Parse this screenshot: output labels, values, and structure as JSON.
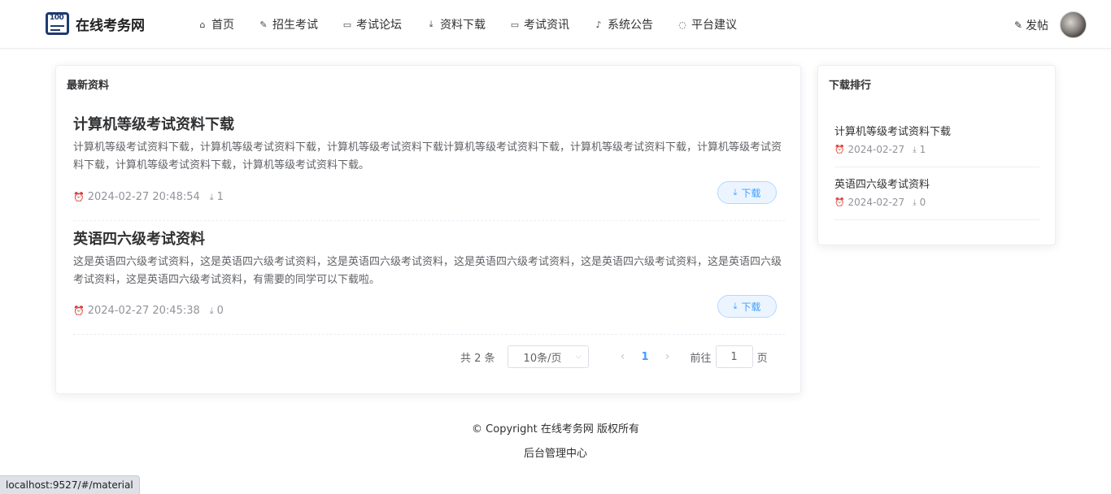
{
  "brand": {
    "logo_number": "100",
    "name": "在线考务网"
  },
  "nav": {
    "items": [
      {
        "icon": "home-icon",
        "glyph": "⌂",
        "label": "首页"
      },
      {
        "icon": "edit-icon",
        "glyph": "✎",
        "label": "招生考试"
      },
      {
        "icon": "chat-icon",
        "glyph": "▭",
        "label": "考试论坛"
      },
      {
        "icon": "download-icon",
        "glyph": "⤓",
        "label": "资料下载"
      },
      {
        "icon": "chat-icon",
        "glyph": "▭",
        "label": "考试资讯"
      },
      {
        "icon": "bell-icon",
        "glyph": "♪",
        "label": "系统公告"
      },
      {
        "icon": "comment-icon",
        "glyph": "◌",
        "label": "平台建议"
      }
    ],
    "post_label": "发帖"
  },
  "latest": {
    "title": "最新资料",
    "items": [
      {
        "title": "计算机等级考试资料下载",
        "desc": "计算机等级考试资料下载，计算机等级考试资料下载，计算机等级考试资料下载计算机等级考试资料下载，计算机等级考试资料下载，计算机等级考试资料下载，计算机等级考试资料下载，计算机等级考试资料下载。",
        "time": "2024-02-27 20:48:54",
        "downloads": "1",
        "button": "下载"
      },
      {
        "title": "英语四六级考试资料",
        "desc": "这是英语四六级考试资料，这是英语四六级考试资料，这是英语四六级考试资料，这是英语四六级考试资料，这是英语四六级考试资料，这是英语四六级考试资料，这是英语四六级考试资料，有需要的同学可以下载啦。",
        "time": "2024-02-27 20:45:38",
        "downloads": "0",
        "button": "下载"
      }
    ]
  },
  "pagination": {
    "total": "共 2 条",
    "page_size": "10条/页",
    "prev": "‹",
    "current_page": "1",
    "next": "›",
    "goto_label": "前往",
    "goto_value": "1",
    "page_unit": "页"
  },
  "ranking": {
    "title": "下载排行",
    "items": [
      {
        "title": "计算机等级考试资料下载",
        "date": "2024-02-27",
        "downloads": "1"
      },
      {
        "title": "英语四六级考试资料",
        "date": "2024-02-27",
        "downloads": "0"
      }
    ]
  },
  "footer": {
    "copyright": "© Copyright 在线考务网 版权所有",
    "admin_link": "后台管理中心"
  },
  "status_bar": {
    "url": "localhost:9527/#/material"
  },
  "colors": {
    "accent": "#409eff",
    "brand": "#1e3a6e"
  }
}
